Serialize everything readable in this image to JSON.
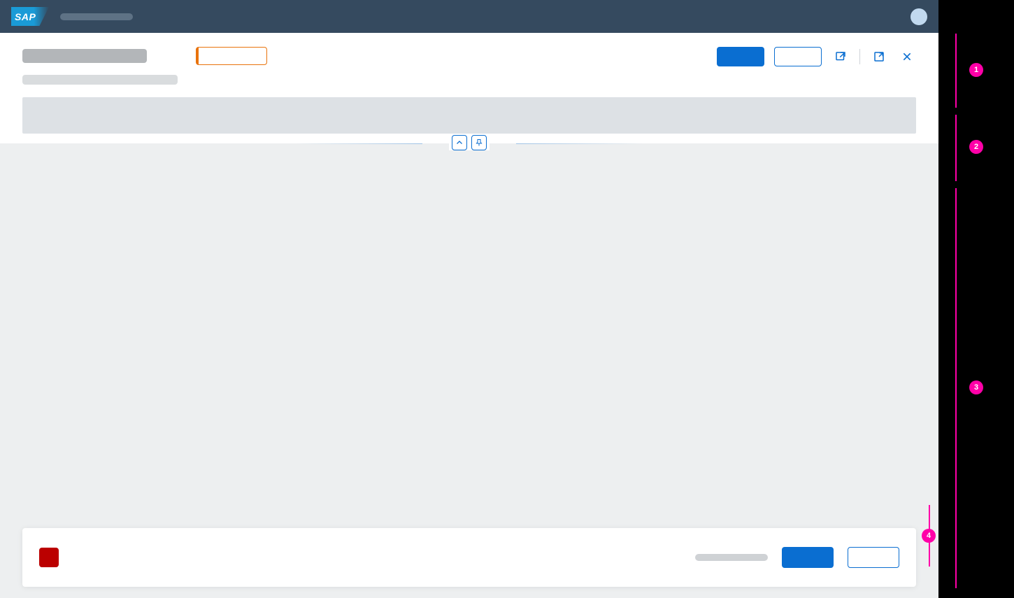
{
  "shell": {
    "logo_text": "SAP",
    "title": ""
  },
  "header": {
    "title": "",
    "subtitle": "",
    "status_text": "",
    "primary_label": "",
    "secondary_label": ""
  },
  "icons": {
    "share": "share-icon",
    "fullscreen": "fullscreen-icon",
    "close": "close-icon",
    "collapse": "chevron-up-icon",
    "pin": "pin-icon"
  },
  "footer": {
    "message": "",
    "hint": "",
    "primary_label": "",
    "secondary_label": ""
  },
  "annotations": {
    "callouts": [
      "1",
      "2",
      "3",
      "4"
    ]
  }
}
